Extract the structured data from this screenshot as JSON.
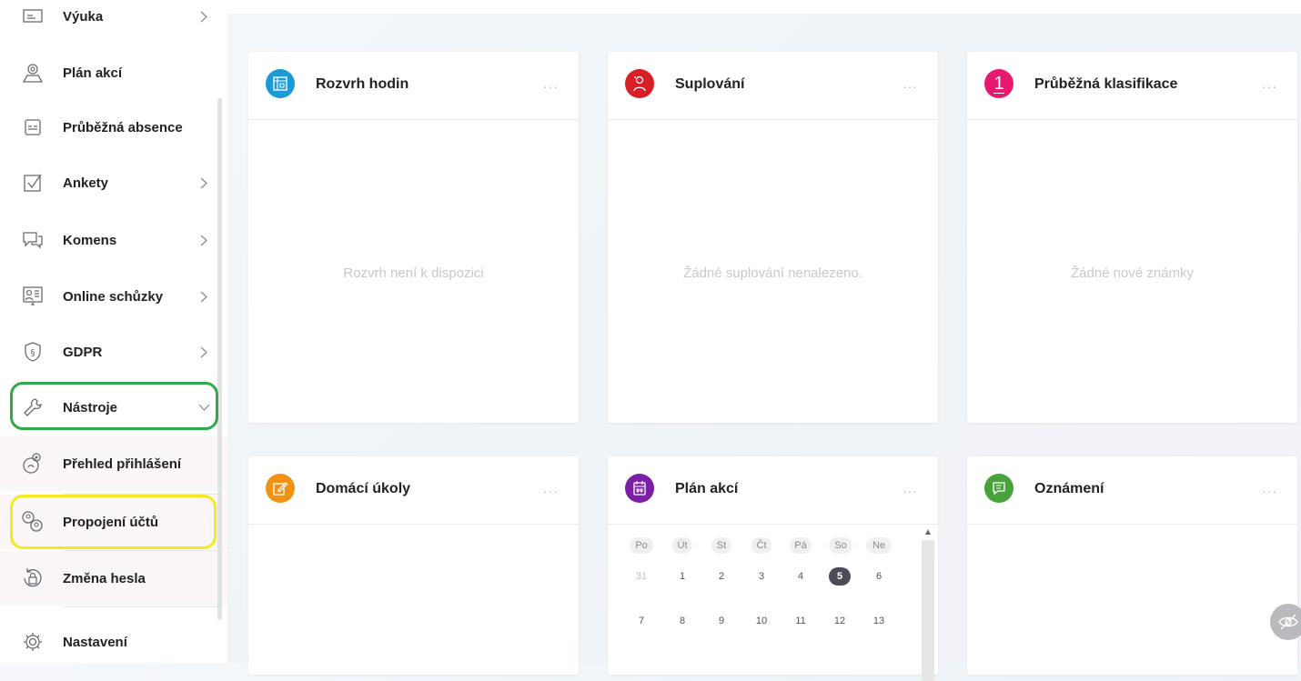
{
  "sidebar": {
    "items": [
      {
        "label": "Výuka",
        "icon": "teaching-icon"
      },
      {
        "label": "Plán akcí",
        "icon": "map-pin-icon"
      },
      {
        "label": "Průběžná absence",
        "icon": "absence-card-icon"
      },
      {
        "label": "Ankety",
        "icon": "checkbox-icon"
      },
      {
        "label": "Komens",
        "icon": "chat-bubbles-icon"
      },
      {
        "label": "Online schůzky",
        "icon": "video-meeting-icon"
      },
      {
        "label": "GDPR",
        "icon": "gdpr-shield-icon"
      },
      {
        "label": "Nástroje",
        "icon": "wrench-icon"
      },
      {
        "label": "Přehled přihlášení",
        "icon": "login-overview-icon"
      },
      {
        "label": "Propojení účtů",
        "icon": "linked-accounts-icon"
      },
      {
        "label": "Změna hesla",
        "icon": "password-lock-icon"
      },
      {
        "label": "Nastavení",
        "icon": "gear-icon"
      }
    ]
  },
  "cards": {
    "rozvrh": {
      "title": "Rozvrh hodin",
      "empty": "Rozvrh není k dispozici",
      "more": "···",
      "color": "#1a9bd7"
    },
    "suplovani": {
      "title": "Suplování",
      "empty": "Žádné suplování nenalezeno.",
      "more": "···",
      "color": "#d71f25"
    },
    "klasifikace": {
      "title": "Průběžná klasifikace",
      "empty": "Žádné nové známky",
      "more": "···",
      "color": "#e8176f",
      "icon_text": "1"
    },
    "ukoly": {
      "title": "Domácí úkoly",
      "more": "···",
      "color": "#f39212"
    },
    "plan": {
      "title": "Plán akcí",
      "more": "···",
      "color": "#7c1fa6"
    },
    "oznameni": {
      "title": "Oznámení",
      "more": "···",
      "color": "#49a33c"
    }
  },
  "calendar": {
    "headers": [
      "Po",
      "Út",
      "St",
      "Čt",
      "Pá",
      "So",
      "Ne"
    ],
    "week1": [
      "31",
      "1",
      "2",
      "3",
      "4",
      "5",
      "6"
    ],
    "week2": [
      "7",
      "8",
      "9",
      "10",
      "11",
      "12",
      "13"
    ],
    "today": "5"
  },
  "colors": {
    "highlight_green": "#2eaa4a",
    "highlight_yellow": "#f4ea1f"
  }
}
